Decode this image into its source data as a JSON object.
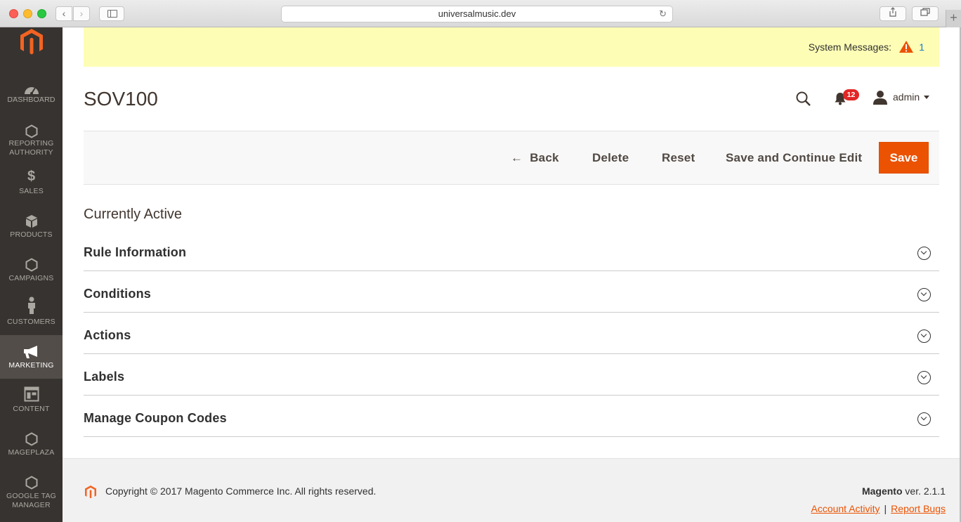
{
  "browser": {
    "url": "universalmusic.dev"
  },
  "nav": {
    "items": [
      {
        "label": "DASHBOARD",
        "icon": "dashboard-icon"
      },
      {
        "label": "REPORTING AUTHORITY",
        "label_line1": "REPORTING",
        "label_line2": "AUTHORITY",
        "icon": "hexagon-icon"
      },
      {
        "label": "SALES",
        "icon": "dollar-icon"
      },
      {
        "label": "PRODUCTS",
        "icon": "box-icon"
      },
      {
        "label": "CAMPAIGNS",
        "icon": "hexagon-icon"
      },
      {
        "label": "CUSTOMERS",
        "icon": "person-icon"
      },
      {
        "label": "MARKETING",
        "icon": "megaphone-icon",
        "active": true
      },
      {
        "label": "CONTENT",
        "icon": "layout-icon"
      },
      {
        "label": "MAGEPLAZA",
        "icon": "hexagon-icon"
      },
      {
        "label": "GOOGLE TAG MANAGER",
        "label_line1": "GOOGLE TAG",
        "label_line2": "MANAGER",
        "icon": "hexagon-icon"
      }
    ]
  },
  "system_messages": {
    "label": "System Messages:",
    "count": "1"
  },
  "header": {
    "title": "SOV100",
    "notifications_count": "12",
    "user_name": "admin"
  },
  "actions": {
    "back": "Back",
    "delete": "Delete",
    "reset": "Reset",
    "save_continue": "Save and Continue Edit",
    "save": "Save"
  },
  "status": "Currently Active",
  "sections": [
    "Rule Information",
    "Conditions",
    "Actions",
    "Labels",
    "Manage Coupon Codes"
  ],
  "footer": {
    "copyright": "Copyright © 2017 Magento Commerce Inc. All rights reserved.",
    "brand": "Magento",
    "version": " ver. 2.1.1",
    "account_activity": "Account Activity",
    "separator": "|",
    "report_bugs": "Report Bugs"
  },
  "colors": {
    "accent": "#eb5202",
    "nav_bg": "#373330",
    "nav_active": "#524d49",
    "message_bg": "#fdfdb6",
    "badge": "#e22626"
  }
}
